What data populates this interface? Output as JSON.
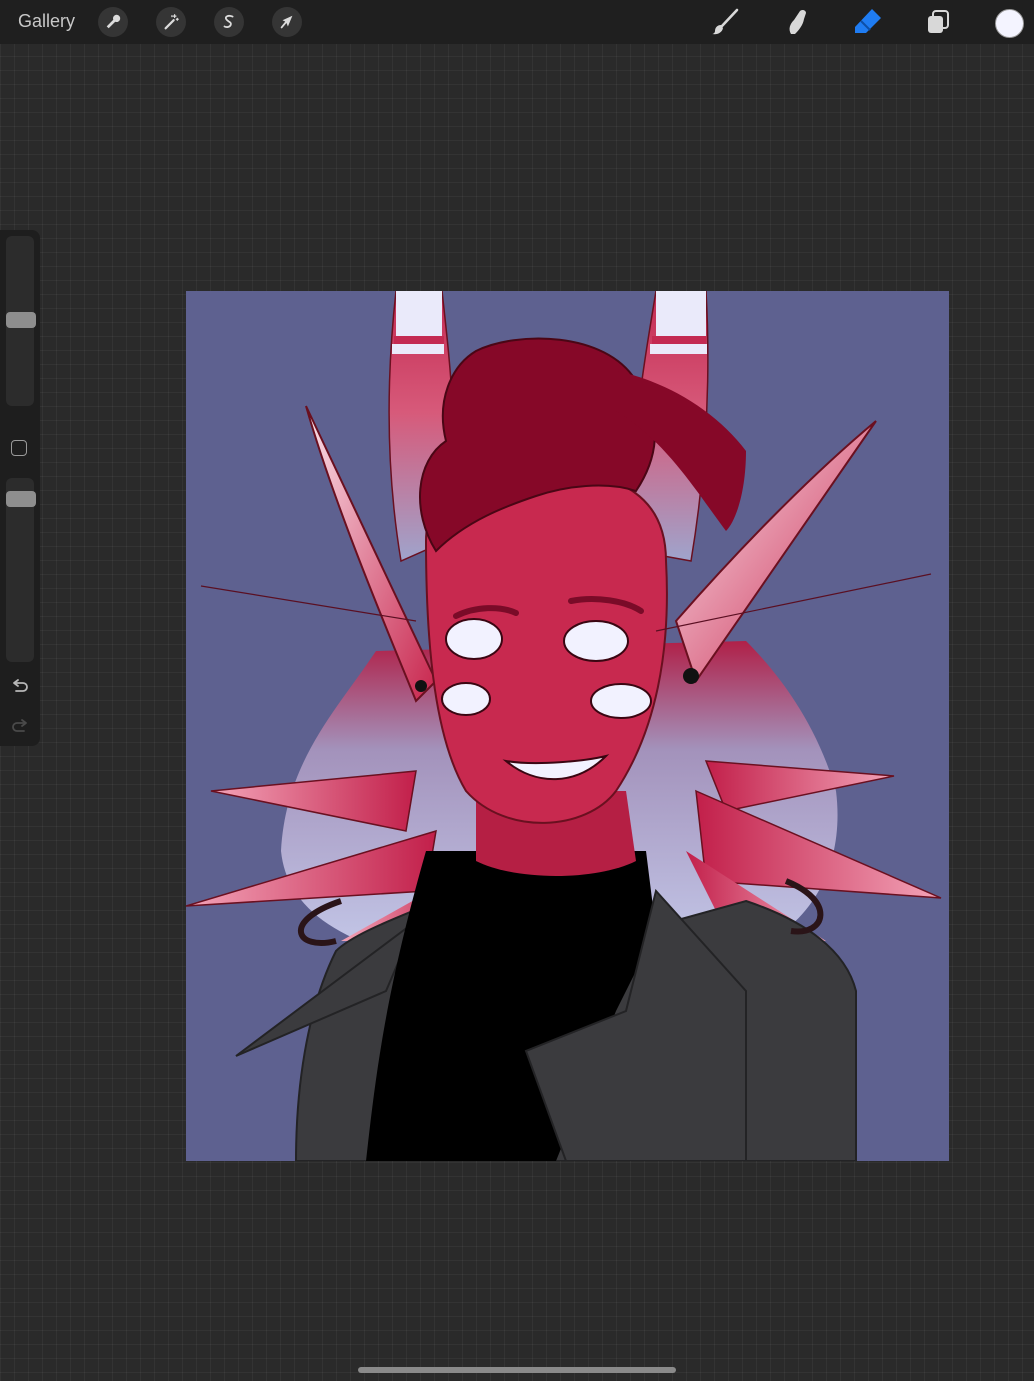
{
  "topbar": {
    "gallery_label": "Gallery",
    "left_tools": [
      {
        "icon": "wrench-icon"
      },
      {
        "icon": "magic-wand-icon"
      },
      {
        "icon": "selection-s-icon"
      },
      {
        "icon": "arrow-cursor-icon"
      }
    ],
    "right_tools": [
      {
        "icon": "brush-icon",
        "active": false
      },
      {
        "icon": "smudge-icon",
        "active": false
      },
      {
        "icon": "eraser-icon",
        "active": true
      },
      {
        "icon": "layers-icon",
        "active": false
      }
    ],
    "current_color": "#f4f4ff",
    "accent_color": "#1f7cf2"
  },
  "sidebar": {
    "brush_size_level": 0.5,
    "opacity_level": 0.95,
    "undo_icon": "undo-icon",
    "redo_icon": "redo-icon"
  },
  "canvas": {
    "background_color": "#5e6190"
  }
}
